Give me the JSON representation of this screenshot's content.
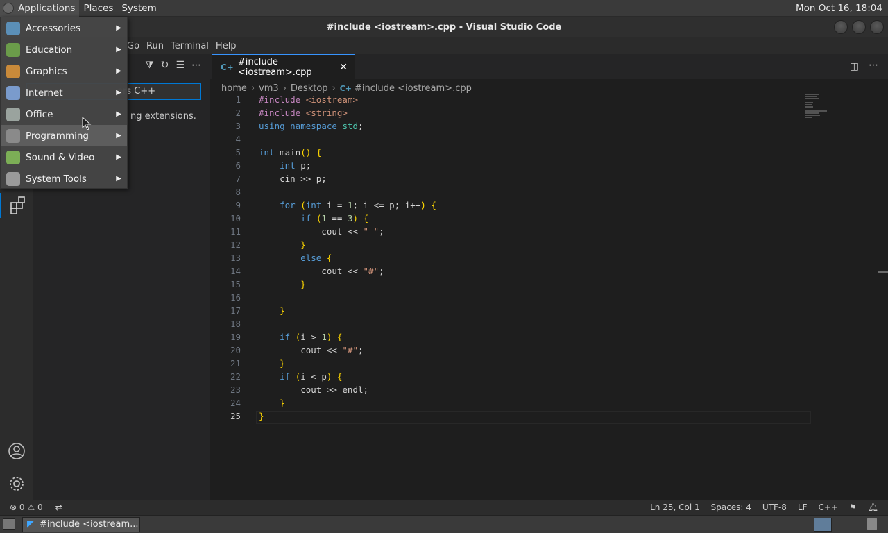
{
  "top_panel": {
    "menus": [
      "Applications",
      "Places",
      "System"
    ],
    "clock": "Mon Oct 16, 18:04"
  },
  "window": {
    "title": "#include <iostream>.cpp - Visual Studio Code"
  },
  "menubar": [
    "Go",
    "Run",
    "Terminal",
    "Help"
  ],
  "app_menu": {
    "items": [
      {
        "label": "Accessories",
        "icon": "accessories-icon"
      },
      {
        "label": "Education",
        "icon": "education-icon"
      },
      {
        "label": "Graphics",
        "icon": "graphics-icon"
      },
      {
        "label": "Internet",
        "icon": "internet-icon"
      },
      {
        "label": "Office",
        "icon": "office-icon"
      },
      {
        "label": "Programming",
        "icon": "programming-icon"
      },
      {
        "label": "Sound & Video",
        "icon": "sound-video-icon"
      },
      {
        "label": "System Tools",
        "icon": "system-tools-icon"
      }
    ],
    "highlighted": "Programming"
  },
  "sidebar": {
    "search_value": "ers C++",
    "note": "ng extensions."
  },
  "editor": {
    "tab_label": "#include <iostream>.cpp",
    "breadcrumb": [
      "home",
      "vm3",
      "Desktop",
      "#include <iostream>.cpp"
    ],
    "lines": [
      "#include <iostream>",
      "#include <string>",
      "using namespace std;",
      "",
      "int main() {",
      "    int p;",
      "    cin >> p;",
      "",
      "    for (int i = 1; i <= p; i++) {",
      "        if (1 == 3) {",
      "            cout << \" \";",
      "        }",
      "        else {",
      "            cout << \"#\";",
      "        }",
      "",
      "    }",
      "",
      "    if (i > 1) {",
      "        cout << \"#\";",
      "    }",
      "    if (i < p) {",
      "        cout >> endl;",
      "    }",
      "}"
    ],
    "current_line": 25
  },
  "statusbar": {
    "errors": "0",
    "warnings": "0",
    "position": "Ln 25, Col 1",
    "spaces": "Spaces: 4",
    "encoding": "UTF-8",
    "eol": "LF",
    "language": "C++"
  },
  "taskbar": {
    "task_label": "#include <iostream..."
  }
}
